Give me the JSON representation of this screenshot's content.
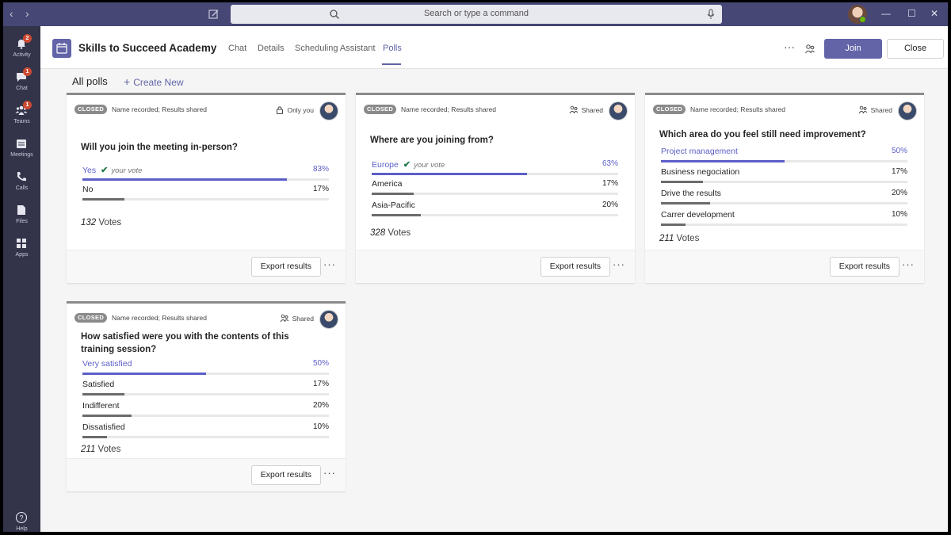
{
  "titlebar": {
    "search_placeholder": "Search or type a command",
    "back": "‹",
    "forward": "›",
    "minimize": "—",
    "maximize": "☐",
    "close": "✕"
  },
  "rail": [
    {
      "label": "Activity",
      "icon": "bell-icon",
      "badge": "2"
    },
    {
      "label": "Chat",
      "icon": "chat-icon",
      "badge": "1"
    },
    {
      "label": "Teams",
      "icon": "teams-icon",
      "badge": "1"
    },
    {
      "label": "Meetings",
      "icon": "calendar-icon",
      "badge": ""
    },
    {
      "label": "Calls",
      "icon": "phone-icon",
      "badge": ""
    },
    {
      "label": "Files",
      "icon": "file-icon",
      "badge": ""
    },
    {
      "label": "Apps",
      "icon": "apps-icon",
      "badge": ""
    },
    {
      "label": "Help",
      "icon": "help-icon",
      "badge": ""
    }
  ],
  "header": {
    "title": "Skills to Succeed Academy",
    "tabs": [
      "Chat",
      "Details",
      "Scheduling Assistant",
      "Polls"
    ],
    "active_tab": "Polls",
    "more": "···",
    "join": "Join",
    "close": "Close"
  },
  "toolbar": {
    "all_polls": "All polls",
    "create_new": "Create New"
  },
  "colors": {
    "brand": "#6264a7",
    "rail": "#33344a",
    "titlebar": "#464775",
    "winning_bar": "#5b5fc7",
    "badge": "#cc4a31"
  },
  "polls": [
    {
      "status": "CLOSED",
      "meta": "Name recorded; Results shared",
      "visibility": "Only you",
      "visibility_icon": "lock-icon",
      "question": "Will you join the meeting in-person?",
      "options": [
        {
          "label": "Yes",
          "pct": "83%",
          "value": 0.83,
          "your_vote": "your vote",
          "winner": true
        },
        {
          "label": "No",
          "pct": "17%",
          "value": 0.17,
          "winner": false
        }
      ],
      "votes_num": "132",
      "votes_word": "Votes",
      "export": "Export results",
      "more": "···"
    },
    {
      "status": "CLOSED",
      "meta": "Name recorded; Results shared",
      "visibility": "Shared",
      "visibility_icon": "share-people-icon",
      "question": "Where are you joining from?",
      "options": [
        {
          "label": "Europe",
          "pct": "63%",
          "value": 0.63,
          "your_vote": "your vote",
          "winner": true
        },
        {
          "label": "America",
          "pct": "17%",
          "value": 0.17,
          "winner": false
        },
        {
          "label": "Asia-Pacific",
          "pct": "20%",
          "value": 0.2,
          "winner": false
        }
      ],
      "votes_num": "328",
      "votes_word": "Votes",
      "export": "Export results",
      "more": "···"
    },
    {
      "status": "CLOSED",
      "meta": "Name recorded; Results shared",
      "visibility": "Shared",
      "visibility_icon": "share-people-icon",
      "question": "Which area do you feel still need improvement?",
      "options": [
        {
          "label": "Project management",
          "pct": "50%",
          "value": 0.5,
          "winner": true
        },
        {
          "label": "Business negociation",
          "pct": "17%",
          "value": 0.17,
          "winner": false
        },
        {
          "label": "Drive the results",
          "pct": "20%",
          "value": 0.2,
          "winner": false
        },
        {
          "label": "Carrer development",
          "pct": "10%",
          "value": 0.1,
          "winner": false
        }
      ],
      "votes_num": "211",
      "votes_word": "Votes",
      "export": "Export results",
      "more": "···"
    },
    {
      "status": "CLOSED",
      "meta": "Name recorded; Results shared",
      "visibility": "Shared",
      "visibility_icon": "share-people-icon",
      "question": "How satisfied were you with the contents of this training session?",
      "options": [
        {
          "label": "Very satisfied",
          "pct": "50%",
          "value": 0.5,
          "winner": true
        },
        {
          "label": "Satisfied",
          "pct": "17%",
          "value": 0.17,
          "winner": false
        },
        {
          "label": "Indifferent",
          "pct": "20%",
          "value": 0.2,
          "winner": false
        },
        {
          "label": "Dissatisfied",
          "pct": "10%",
          "value": 0.1,
          "winner": false
        }
      ],
      "votes_num": "211",
      "votes_word": "Votes",
      "export": "Export results",
      "more": "···"
    }
  ]
}
